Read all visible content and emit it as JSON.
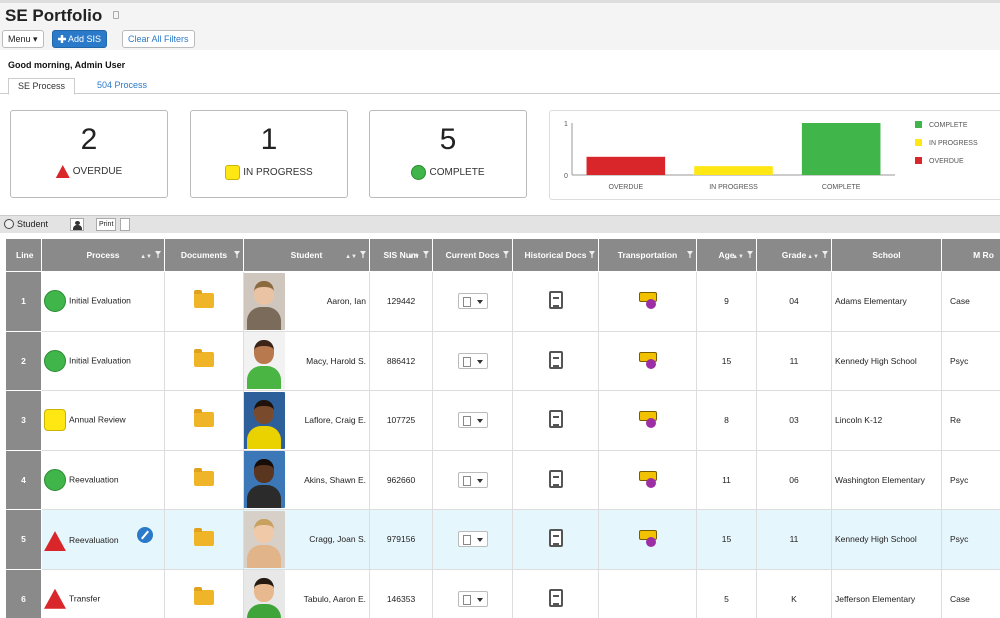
{
  "header": {
    "title": "SE Portfolio",
    "menu_label": "Menu ▾",
    "add_label": "Add SIS",
    "clear_label": "Clear All Filters"
  },
  "greeting": "Good morning, Admin User",
  "tabs": [
    {
      "label": "SE Process"
    },
    {
      "label": "504 Process"
    }
  ],
  "stats": [
    {
      "value": "2",
      "label": "OVERDUE",
      "icon": "triangle-icon",
      "color": "#d9262a"
    },
    {
      "value": "1",
      "label": "IN PROGRESS",
      "icon": "square-icon",
      "color": "#ffe713"
    },
    {
      "value": "5",
      "label": "COMPLETE",
      "icon": "circle-icon",
      "color": "#3fb54a"
    }
  ],
  "chart_data": {
    "type": "bar",
    "categories": [
      "OVERDUE",
      "IN PROGRESS",
      "COMPLETE"
    ],
    "values": [
      0.35,
      0.17,
      1.0
    ],
    "colors": [
      "#d9262a",
      "#ffe713",
      "#3fb54a"
    ],
    "ylim": [
      0,
      1
    ],
    "yticks": [
      "0",
      "1"
    ],
    "legend": [
      "COMPLETE",
      "IN PROGRESS",
      "OVERDUE"
    ],
    "legend_colors": [
      "#3fb54a",
      "#ffe713",
      "#d9262a"
    ],
    "legend_position": "right"
  },
  "section": {
    "label": "Student",
    "print_label": "Print"
  },
  "table": {
    "columns": [
      "Line",
      "Process",
      "Documents",
      "Student",
      "SIS Num",
      "Current Docs",
      "Historical Docs",
      "Transportation",
      "Age",
      "Grade",
      "School",
      "M Ro"
    ],
    "rows": [
      {
        "line": "1",
        "status": "complete",
        "process": "Initial Evaluation",
        "student": "Aaron, Ian",
        "sis": "129442",
        "age": "9",
        "grade": "04",
        "school": "Adams Elementary",
        "last": "Case",
        "transport": true,
        "edit": false,
        "skin": "#e9c3a3",
        "hair": "#8a6a3e",
        "shirt": "#7b6b5a",
        "bg": "#cfc7be"
      },
      {
        "line": "2",
        "status": "complete",
        "process": "Initial Evaluation",
        "student": "Macy, Harold S.",
        "sis": "886412",
        "age": "15",
        "grade": "11",
        "school": "Kennedy High School",
        "last": "Psyc",
        "transport": true,
        "edit": false,
        "skin": "#b8794e",
        "hair": "#3b2418",
        "shirt": "#4bb543",
        "bg": "#f2f2f2"
      },
      {
        "line": "3",
        "status": "progress",
        "process": "Annual Review",
        "student": "Laflore, Craig E.",
        "sis": "107725",
        "age": "8",
        "grade": "03",
        "school": "Lincoln K-12",
        "last": "Re",
        "transport": true,
        "edit": false,
        "skin": "#7a4a2c",
        "hair": "#1e130c",
        "shirt": "#e9d200",
        "bg": "#2d5f9a"
      },
      {
        "line": "4",
        "status": "complete",
        "process": "Reevaluation",
        "student": "Akins, Shawn E.",
        "sis": "962660",
        "age": "11",
        "grade": "06",
        "school": "Washington Elementary",
        "last": "Psyc",
        "transport": true,
        "edit": false,
        "skin": "#5a3520",
        "hair": "#160d08",
        "shirt": "#2b2b2b",
        "bg": "#3c78b8"
      },
      {
        "line": "5",
        "status": "overdue",
        "process": "Reevaluation",
        "student": "Cragg, Joan S.",
        "sis": "979156",
        "age": "15",
        "grade": "11",
        "school": "Kennedy High School",
        "last": "Psyc",
        "transport": true,
        "edit": true,
        "skin": "#f0c9a8",
        "hair": "#c8a060",
        "shirt": "#e2b48a",
        "bg": "#d6d0c8"
      },
      {
        "line": "6",
        "status": "overdue",
        "process": "Transfer",
        "student": "Tabulo, Aaron E.",
        "sis": "146353",
        "age": "5",
        "grade": "K",
        "school": "Jefferson Elementary",
        "last": "Case",
        "transport": false,
        "edit": false,
        "skin": "#e8b88f",
        "hair": "#241a12",
        "shirt": "#3fa53a",
        "bg": "#e8e8e8"
      }
    ]
  }
}
